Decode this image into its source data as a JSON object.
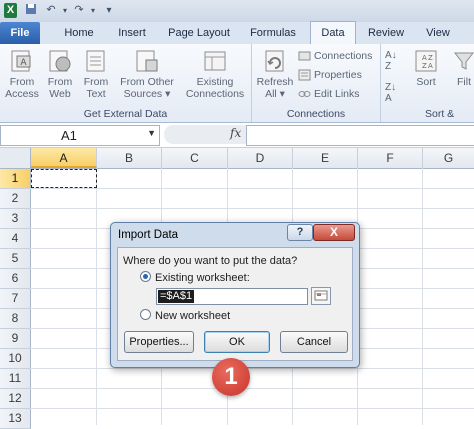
{
  "qat": {
    "save_icon": "save-icon",
    "undo_icon": "undo-icon",
    "redo_icon": "redo-icon"
  },
  "tabs": [
    {
      "label": "File"
    },
    {
      "label": "Home"
    },
    {
      "label": "Insert"
    },
    {
      "label": "Page Layout"
    },
    {
      "label": "Formulas"
    },
    {
      "label": "Data"
    },
    {
      "label": "Review"
    },
    {
      "label": "View"
    }
  ],
  "ribbon": {
    "get_external": {
      "label": "Get External Data",
      "buttons": [
        {
          "line1": "From",
          "line2": "Access"
        },
        {
          "line1": "From",
          "line2": "Web"
        },
        {
          "line1": "From",
          "line2": "Text"
        },
        {
          "line1": "From Other",
          "line2": "Sources ▾"
        },
        {
          "line1": "Existing",
          "line2": "Connections"
        }
      ]
    },
    "connections": {
      "label": "Connections",
      "refresh": {
        "line1": "Refresh",
        "line2": "All ▾"
      },
      "connections_btn": "Connections",
      "properties_btn": "Properties",
      "edit_links_btn": "Edit Links"
    },
    "sort": {
      "label": "Sort &",
      "sort_btn": "Sort",
      "filter_partial": "Filt"
    }
  },
  "formula_bar": {
    "name_box": "A1",
    "fx": "fx",
    "formula": ""
  },
  "grid": {
    "columns": [
      "A",
      "B",
      "C",
      "D",
      "E",
      "F",
      "G"
    ],
    "rows": [
      "1",
      "2",
      "3",
      "4",
      "5",
      "6",
      "7",
      "8",
      "9",
      "10",
      "11",
      "12",
      "13"
    ],
    "active_cell": "A1"
  },
  "dialog": {
    "title": "Import Data",
    "help": "?",
    "close": "X",
    "prompt": "Where do you want to put the data?",
    "option_existing": "Existing worksheet:",
    "option_new": "New worksheet",
    "range_value": "=$A$1",
    "properties_btn": "Properties...",
    "ok_btn": "OK",
    "cancel_btn": "Cancel"
  },
  "step_marker": "1",
  "colors": {
    "accent_file_tab": "#2b5ea8",
    "active_header": "#f8cf68",
    "step_badge": "#c9342a"
  }
}
